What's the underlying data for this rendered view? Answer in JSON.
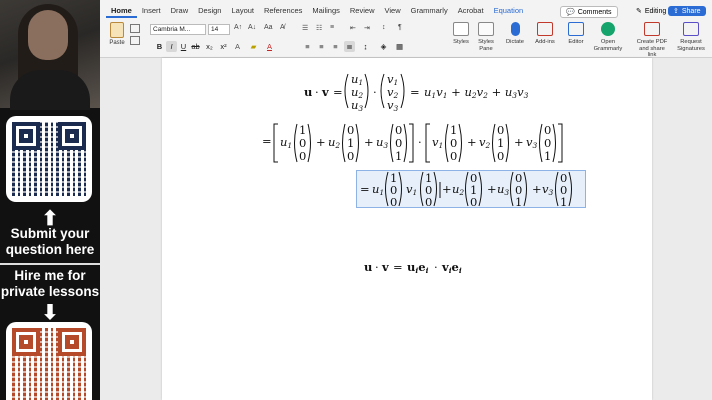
{
  "overlay": {
    "cta_submit": "Submit your question here",
    "cta_hire": "Hire me for private lessons",
    "arrow_glyph": "⬆",
    "arrow_down_glyph": "⬇"
  },
  "ribbon": {
    "tabs": [
      "Home",
      "Insert",
      "Draw",
      "Design",
      "Layout",
      "References",
      "Mailings",
      "Review",
      "View",
      "Grammarly",
      "Acrobat",
      "Equation"
    ],
    "active_tab": "Home",
    "comments_label": "Comments",
    "editing_label": "Editing",
    "share_label": "Share",
    "paste_label": "Paste",
    "font_name": "Cambria M...",
    "font_size": "14",
    "styles_label": "Styles",
    "styles_pane_label": "Styles Pane",
    "dictate_label": "Dictate",
    "addins_label": "Add-ins",
    "editor_label": "Editor",
    "grammarly_label": "Open Grammarly",
    "create_pdf_label": "Create PDF and share link",
    "request_sig_label": "Request Signatures",
    "accent": "#2b6cd4"
  },
  "equations": {
    "eq1": {
      "lhs": "u · v",
      "vec1": [
        "u1",
        "u2",
        "u3"
      ],
      "vec2": [
        "v1",
        "v2",
        "v3"
      ],
      "rhs": "u1v1 + u2v2 + u3v3"
    },
    "eq2": {
      "coeffs_u": [
        "u1",
        "u2",
        "u3"
      ],
      "coeffs_v": [
        "v1",
        "v2",
        "v3"
      ],
      "basis": [
        [
          "1",
          "0",
          "0"
        ],
        [
          "0",
          "1",
          "0"
        ],
        [
          "0",
          "0",
          "1"
        ]
      ]
    },
    "eq3": {
      "note": "expanded form"
    },
    "eq4": {
      "text": "u · v = uᵢeᵢ · vᵢeᵢ"
    }
  }
}
